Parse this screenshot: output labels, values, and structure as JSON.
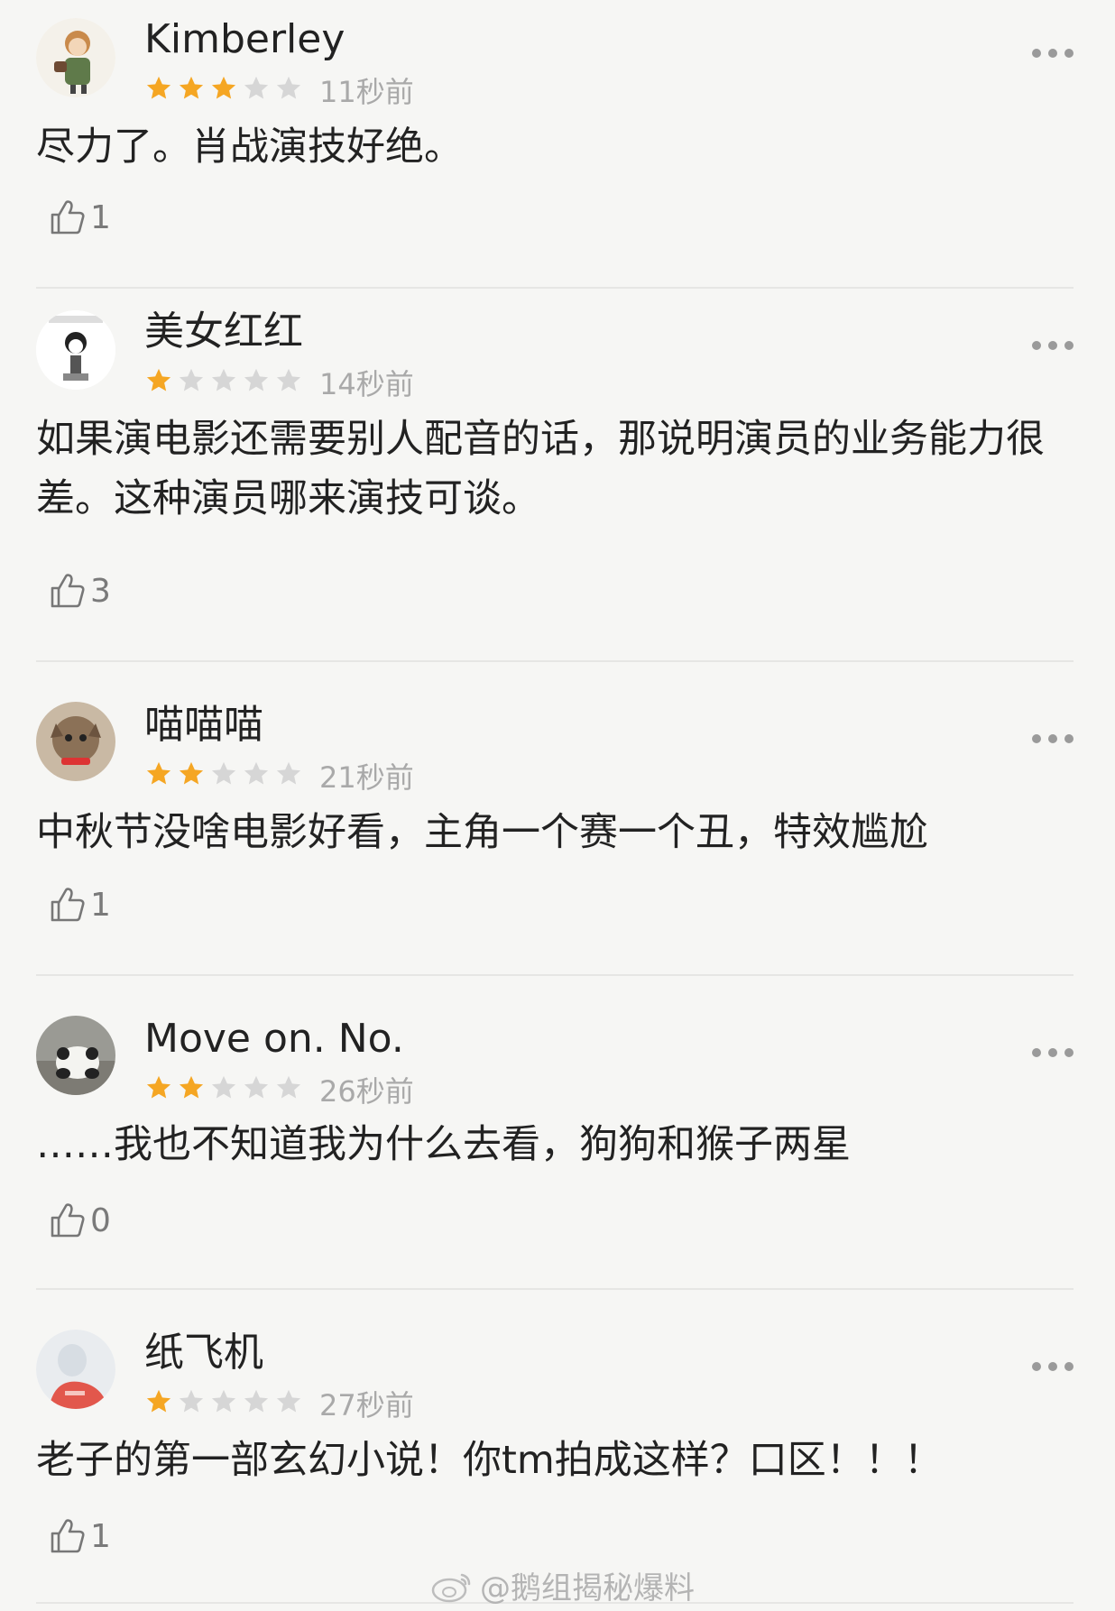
{
  "colors": {
    "star_on": "#f5a623",
    "star_off": "#d6d6d6",
    "meta_text": "#a9a9a9"
  },
  "reviews": [
    {
      "username": "Kimberley",
      "rating": 3,
      "time": "11秒前",
      "text": "尽力了。肖战演技好绝。",
      "likes": "1"
    },
    {
      "username": "美女红红",
      "rating": 1,
      "time": "14秒前",
      "text": "如果演电影还需要别人配音的话，那说明演员的业务能力很差。这种演员哪来演技可谈。",
      "likes": "3"
    },
    {
      "username": "喵喵喵",
      "rating": 2,
      "time": "21秒前",
      "text": "中秋节没啥电影好看，主角一个赛一个丑，特效尴尬",
      "likes": "1"
    },
    {
      "username": "Move on. No.",
      "rating": 2,
      "time": "26秒前",
      "text": "……我也不知道我为什么去看，狗狗和猴子两星",
      "likes": "0"
    },
    {
      "username": "纸飞机",
      "rating": 1,
      "time": "27秒前",
      "text": "老子的第一部玄幻小说！你tm拍成这样？口区！！！",
      "likes": "1"
    }
  ],
  "avatars": [
    "cartoon-boy-avatar",
    "meme-avatar",
    "cat-avatar",
    "panda-avatar",
    "girl-illustration-avatar"
  ],
  "watermark": "@鹅组揭秘爆料"
}
